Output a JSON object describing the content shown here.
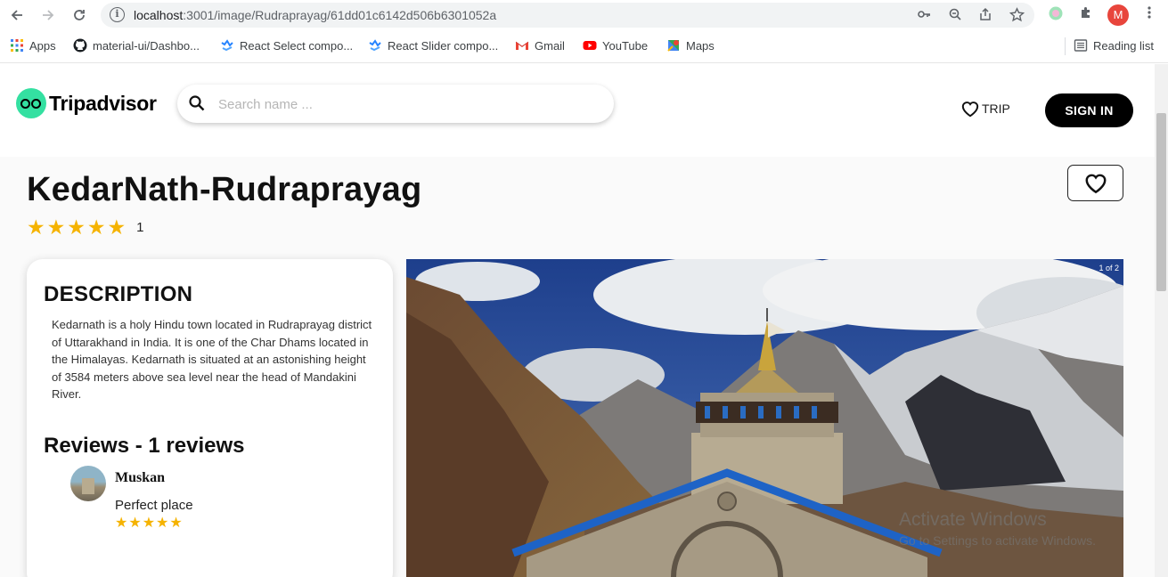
{
  "browser": {
    "url_host": "localhost",
    "url_path": ":3001/image/Rudraprayag/61dd01c6142d506b6301052a",
    "profile_initial": "M",
    "bookmarks": [
      {
        "label": "Apps"
      },
      {
        "label": "material-ui/Dashbo..."
      },
      {
        "label": "React Select compo..."
      },
      {
        "label": "React Slider compo..."
      },
      {
        "label": "Gmail"
      },
      {
        "label": "YouTube"
      },
      {
        "label": "Maps"
      }
    ],
    "reading_list": "Reading list"
  },
  "header": {
    "brand": "Tripadvisor",
    "search_placeholder": "Search name ...",
    "trip_label": "TRIP",
    "signin_label": "SIGN IN"
  },
  "place": {
    "title": "KedarNath-Rudraprayag",
    "rating": 5,
    "rating_count": "1"
  },
  "description": {
    "heading": "DESCRIPTION",
    "text": "Kedarnath is a holy Hindu town located in Rudraprayag district of Uttarakhand in India. It is one of the Char Dhams located in the Himalayas. Kedarnath is situated at an astonishing height of 3584 meters above sea level near the head of Mandakini River."
  },
  "reviews": {
    "heading": "Reviews - 1 reviews",
    "items": [
      {
        "name": "Muskan",
        "text": "Perfect place",
        "rating": 5
      }
    ]
  },
  "gallery": {
    "counter": "1 of 2"
  },
  "watermark": {
    "line1": "Activate Windows",
    "line2": "Go to Settings to activate Windows."
  }
}
